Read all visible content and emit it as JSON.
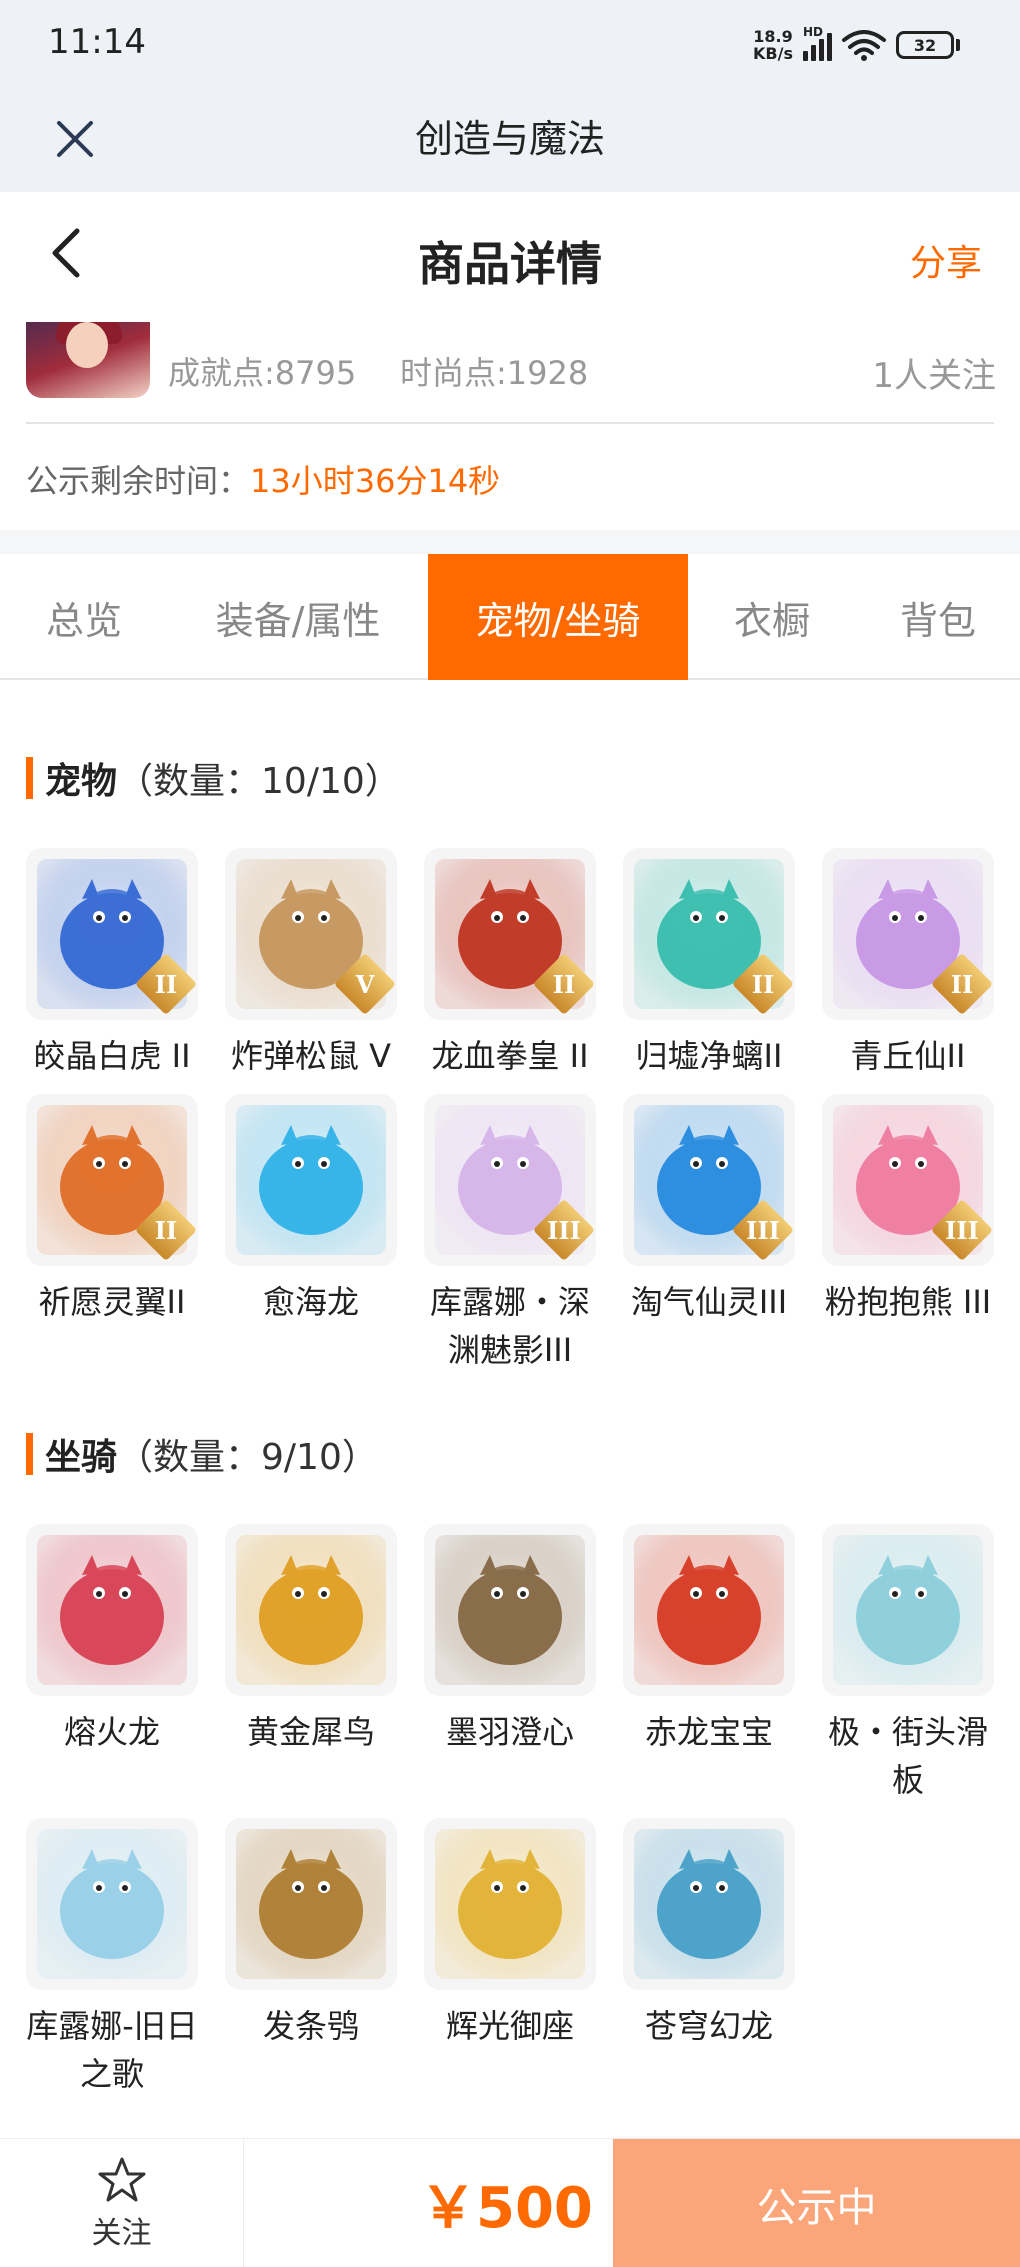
{
  "status_bar": {
    "time": "11:14",
    "net_speed_value": "18.9",
    "net_speed_unit": "KB/s",
    "network_label": "HD",
    "battery": "32"
  },
  "webview": {
    "title": "创造与魔法",
    "close_icon": "close-icon"
  },
  "header": {
    "title": "商品详情",
    "share": "分享",
    "back_icon": "chevron-left-icon"
  },
  "seller": {
    "achievement": "成就点:8795",
    "fashion": "时尚点:1928",
    "followers": "1人关注"
  },
  "notice": {
    "label": "公示剩余时间：",
    "value": "13小时36分14秒"
  },
  "tabs": [
    {
      "label": "总览",
      "active": false
    },
    {
      "label": "装备/属性",
      "active": false
    },
    {
      "label": "宠物/坐骑",
      "active": true
    },
    {
      "label": "衣橱",
      "active": false
    },
    {
      "label": "背包",
      "active": false
    }
  ],
  "pets": {
    "title": "宠物",
    "count": "（数量：10/10）",
    "items": [
      {
        "name": "皎晶白虎 II",
        "rank": "II",
        "color": "#3c6fd6"
      },
      {
        "name": "炸弹松鼠 V",
        "rank": "V",
        "color": "#c89a63"
      },
      {
        "name": "龙血拳皇 II",
        "rank": "II",
        "color": "#c23c2a"
      },
      {
        "name": "归墟净螭II",
        "rank": "II",
        "color": "#3fbfb0"
      },
      {
        "name": "青丘仙II",
        "rank": "II",
        "color": "#c99be6"
      },
      {
        "name": "祈愿灵翼II",
        "rank": "II",
        "color": "#e0732f"
      },
      {
        "name": "愈海龙",
        "rank": "",
        "color": "#37b4e8"
      },
      {
        "name": "库露娜・深渊魅影III",
        "rank": "III",
        "color": "#d7b7ea"
      },
      {
        "name": "淘气仙灵III",
        "rank": "III",
        "color": "#2e8fe0"
      },
      {
        "name": "粉抱抱熊 III",
        "rank": "III",
        "color": "#ef7fa3"
      }
    ]
  },
  "mounts": {
    "title": "坐骑",
    "count": "（数量：9/10）",
    "items": [
      {
        "name": "熔火龙",
        "color": "#d8485a"
      },
      {
        "name": "黄金犀鸟",
        "color": "#e0a22a"
      },
      {
        "name": "墨羽澄心",
        "color": "#8a6d4a"
      },
      {
        "name": "赤龙宝宝",
        "color": "#d8422c"
      },
      {
        "name": "极・街头滑板",
        "color": "#8fd0dc"
      },
      {
        "name": "库露娜-旧日之歌",
        "color": "#9ad1e8"
      },
      {
        "name": "发条鸮",
        "color": "#b0823a"
      },
      {
        "name": "辉光御座",
        "color": "#e3b43a"
      },
      {
        "name": "苍穹幻龙",
        "color": "#4da3c9"
      }
    ]
  },
  "bottom": {
    "follow": "关注",
    "price": "￥500",
    "status": "公示中"
  },
  "colors": {
    "accent": "#ff6a00",
    "status_button": "#fba57a"
  }
}
